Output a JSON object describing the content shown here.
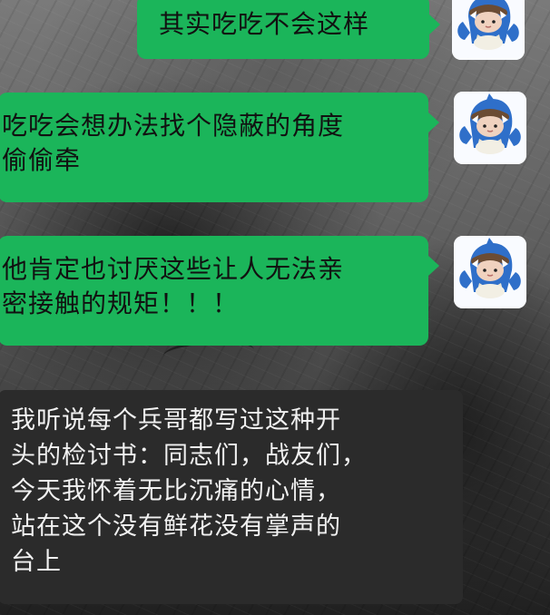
{
  "conversation": {
    "messages": [
      {
        "sender": "self",
        "text": "其实吃吃不会这样",
        "avatar_icon": "shark-hat-doll-icon",
        "colors": {
          "bubble": "#1bb55a"
        }
      },
      {
        "sender": "self",
        "text": "吃吃会想办法找个隐蔽的角度\n偷偷牵",
        "avatar_icon": "shark-hat-doll-icon",
        "colors": {
          "bubble": "#1bb55a"
        }
      },
      {
        "sender": "self",
        "text": "他肯定也讨厌这些让人无法亲\n密接触的规矩！！！",
        "avatar_icon": "shark-hat-doll-icon",
        "colors": {
          "bubble": "#1bb55a"
        }
      },
      {
        "sender": "other",
        "text": "我听说每个兵哥都写过这种开\n头的检讨书：同志们，战友们，\n今天我怀着无比沉痛的心情，\n站在这个没有鲜花没有掌声的\n台上",
        "colors": {
          "bubble": "#2b2b2b"
        }
      }
    ]
  }
}
